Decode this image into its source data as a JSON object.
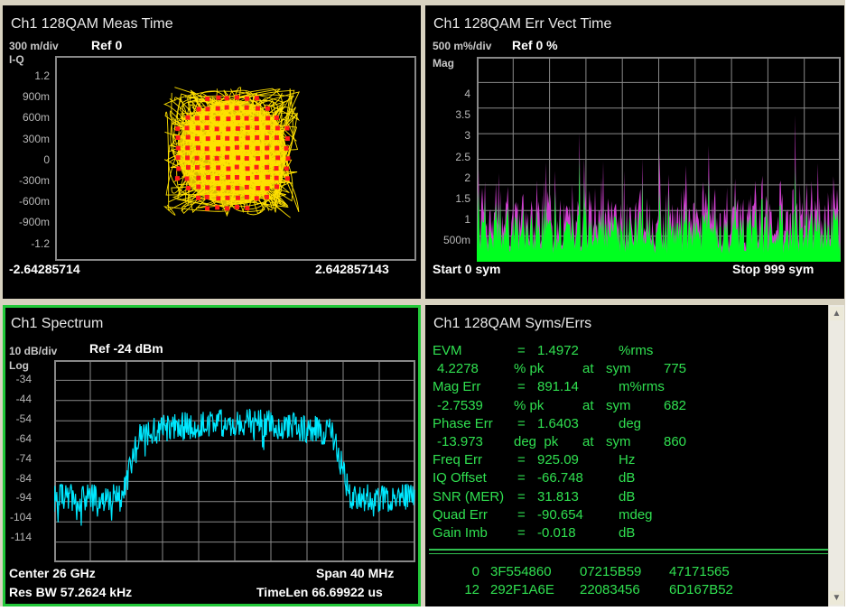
{
  "colors": {
    "constellation_symbol": "#ff1a1a",
    "constellation_trace": "#ffe000",
    "err_mag": "#00ff20",
    "err_peak": "#d040d0",
    "spectrum": "#00e8ff",
    "grid": "#777777",
    "text_green": "#30e050"
  },
  "pane1": {
    "title": "Ch1 128QAM Meas Time",
    "scale": "300 m/div",
    "ref": "Ref 0",
    "format": "I-Q",
    "yticks": [
      "1.2",
      "900m",
      "600m",
      "300m",
      "0",
      "-300m",
      "-600m",
      "-900m",
      "-1.2"
    ],
    "xstart": "-2.64285714",
    "xstop": "2.642857143"
  },
  "pane2": {
    "title": "Ch1 128QAM Err Vect Time",
    "scale": "500 m%/div",
    "ref": "Ref 0 %",
    "format": "Mag",
    "yticks": [
      "4",
      "3.5",
      "3",
      "2.5",
      "2",
      "1.5",
      "1",
      "500m"
    ],
    "start": "Start 0  sym",
    "stop": "Stop 999  sym"
  },
  "pane3": {
    "title": "Ch1 Spectrum",
    "scale": "10 dB/div",
    "ref": "Ref -24 dBm",
    "format": "Log",
    "yticks": [
      "-34",
      "-44",
      "-54",
      "-64",
      "-74",
      "-84",
      "-94",
      "-104",
      "-114"
    ],
    "center": "Center 26 GHz",
    "span": "Span 40 MHz",
    "resbw": "Res BW 57.2624 kHz",
    "timelen": "TimeLen 66.69922 us"
  },
  "pane4": {
    "title": "Ch1 128QAM Syms/Errs",
    "rows": [
      [
        "EVM",
        "=",
        "1.4972",
        "%rms",
        "",
        ""
      ],
      [
        "4.2278",
        "",
        "% pk",
        "at",
        "sym",
        "775"
      ],
      [
        "Mag Err",
        "=",
        "891.14",
        "m%rms",
        "",
        ""
      ],
      [
        "-2.7539",
        "",
        "% pk",
        "at",
        "sym",
        "682"
      ],
      [
        "Phase Err",
        "=",
        "1.6403",
        "deg",
        "",
        ""
      ],
      [
        "-13.973",
        "",
        "deg  pk",
        "at",
        "sym",
        "860"
      ],
      [
        "Freq Err",
        "=",
        "925.09",
        "Hz",
        "",
        ""
      ],
      [
        "IQ Offset",
        "=",
        "-66.748",
        "dB",
        "",
        ""
      ],
      [
        "SNR (MER)",
        "=",
        "31.813",
        "dB",
        "",
        ""
      ],
      [
        "Quad Err",
        "=",
        "-90.654",
        "mdeg",
        "",
        ""
      ],
      [
        "Gain Imb",
        "=",
        "-0.018",
        "dB",
        "",
        ""
      ]
    ],
    "symbols": [
      {
        "index": "0",
        "words": [
          "3F554860",
          "07215B59",
          "47171565"
        ]
      },
      {
        "index": "12",
        "words": [
          "292F1A6E",
          "22083456",
          "6D167B52"
        ]
      }
    ]
  }
}
